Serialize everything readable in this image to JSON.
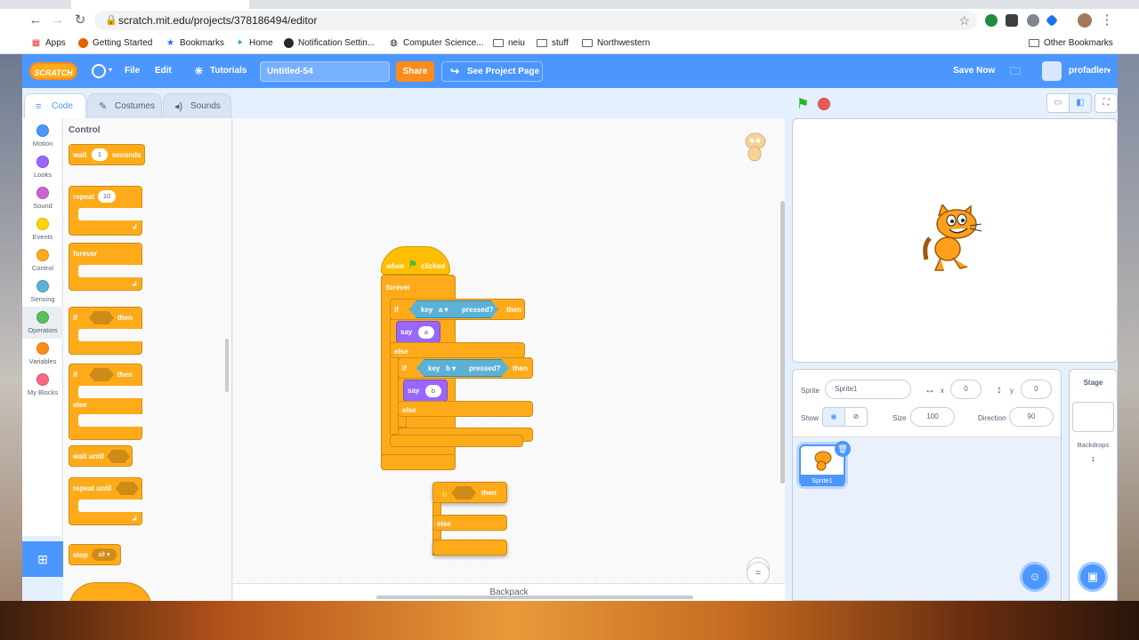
{
  "browser": {
    "url": "scratch.mit.edu/projects/378186494/editor",
    "bookmarks": [
      "Apps",
      "Getting Started",
      "Bookmarks",
      "Home",
      "Notification Settin...",
      "Computer Science...",
      "neiu",
      "stuff",
      "Northwestern"
    ],
    "other_bookmarks": "Other Bookmarks"
  },
  "menubar": {
    "logo": "SCRATCH",
    "file": "File",
    "edit": "Edit",
    "tutorials": "Tutorials",
    "project_title": "Untitled-54",
    "share": "Share",
    "see_project_page": "See Project Page",
    "save_now": "Save Now",
    "username": "profadler"
  },
  "tabs": {
    "code": "Code",
    "costumes": "Costumes",
    "sounds": "Sounds"
  },
  "categories": [
    {
      "label": "Motion",
      "color": "#4c97ff"
    },
    {
      "label": "Looks",
      "color": "#9966ff"
    },
    {
      "label": "Sound",
      "color": "#cf63cf"
    },
    {
      "label": "Events",
      "color": "#ffd500"
    },
    {
      "label": "Control",
      "color": "#ffab19"
    },
    {
      "label": "Sensing",
      "color": "#5cb1d6"
    },
    {
      "label": "Operators",
      "color": "#59c059"
    },
    {
      "label": "Variables",
      "color": "#ff8c1a"
    },
    {
      "label": "My Blocks",
      "color": "#ff6680"
    }
  ],
  "palette": {
    "heading": "Control",
    "wait": "wait",
    "wait_value": "1",
    "seconds": "seconds",
    "repeat": "repeat",
    "repeat_value": "10",
    "forever": "forever",
    "if": "if",
    "then": "then",
    "else": "else",
    "wait_until": "wait until",
    "repeat_until": "repeat until",
    "stop": "stop",
    "stop_value": "all ▾"
  },
  "script": {
    "hat": "when",
    "clicked": "clicked",
    "forever": "forever",
    "if": "if",
    "then": "then",
    "else": "else",
    "key": "key",
    "key_a": "a ▾",
    "key_b": "b ▾",
    "pressed": "pressed?",
    "say": "say",
    "say_a": "a",
    "say_b": "b"
  },
  "workspace": {
    "backpack": "Backpack"
  },
  "sprite_info": {
    "sprite_label": "Sprite",
    "sprite_name": "Sprite1",
    "x_label": "x",
    "x": "0",
    "y_label": "y",
    "y": "0",
    "show_label": "Show",
    "size_label": "Size",
    "size": "100",
    "direction_label": "Direction",
    "direction": "90"
  },
  "sprite_list": [
    {
      "name": "Sprite1"
    }
  ],
  "stage_pane": {
    "title": "Stage",
    "backdrops_label": "Backdrops",
    "backdrops_count": "1"
  }
}
